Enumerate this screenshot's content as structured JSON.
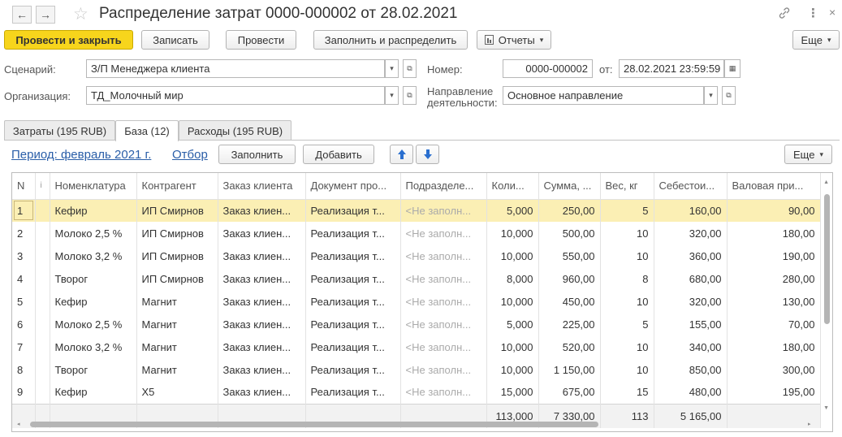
{
  "window": {
    "title": "Распределение затрат 0000-000002 от 28.02.2021",
    "back_icon": "←",
    "forward_icon": "→",
    "star_icon": "☆",
    "link_icon": "🔗",
    "more_icon": "⋮",
    "close_icon": "×"
  },
  "toolbar": {
    "post_close": "Провести и закрыть",
    "save": "Записать",
    "post": "Провести",
    "fill_distribute": "Заполнить и распределить",
    "reports": "Отчеты",
    "more": "Еще"
  },
  "form": {
    "scenario_label": "Сценарий:",
    "scenario_value": "З/П Менеджера клиента",
    "org_label": "Организация:",
    "org_value": "ТД_Молочный мир",
    "number_label": "Номер:",
    "number_value": "0000-000002",
    "date_label": "от:",
    "date_value": "28.02.2021 23:59:59",
    "direction_label_1": "Направление",
    "direction_label_2": "деятельности:",
    "direction_value": "Основное направление"
  },
  "tabs": [
    {
      "label": "Затраты (195 RUB)"
    },
    {
      "label": "База (12)"
    },
    {
      "label": "Расходы (195 RUB)"
    }
  ],
  "subbar": {
    "period": "Период: февраль 2021 г.",
    "filter": "Отбор",
    "fill": "Заполнить",
    "add": "Добавить",
    "up_icon": "🡅",
    "down_icon": "🡇",
    "more": "Еще"
  },
  "table": {
    "headers": [
      "N",
      "і",
      "Номенклатура",
      "Контрагент",
      "Заказ клиента",
      "Документ про...",
      "Подразделе...",
      "Коли...",
      "Сумма, ...",
      "Вес, кг",
      "Себестои...",
      "Валовая при..."
    ],
    "rows": [
      [
        "1",
        "Кефир",
        "ИП Смирнов",
        "Заказ клиен...",
        "Реализация т...",
        "<Не заполн...",
        "5,000",
        "250,00",
        "5",
        "160,00",
        "90,00"
      ],
      [
        "2",
        "Молоко 2,5 %",
        "ИП Смирнов",
        "Заказ клиен...",
        "Реализация т...",
        "<Не заполн...",
        "10,000",
        "500,00",
        "10",
        "320,00",
        "180,00"
      ],
      [
        "3",
        "Молоко 3,2 %",
        "ИП Смирнов",
        "Заказ клиен...",
        "Реализация т...",
        "<Не заполн...",
        "10,000",
        "550,00",
        "10",
        "360,00",
        "190,00"
      ],
      [
        "4",
        "Творог",
        "ИП Смирнов",
        "Заказ клиен...",
        "Реализация т...",
        "<Не заполн...",
        "8,000",
        "960,00",
        "8",
        "680,00",
        "280,00"
      ],
      [
        "5",
        "Кефир",
        "Магнит",
        "Заказ клиен...",
        "Реализация т...",
        "<Не заполн...",
        "10,000",
        "450,00",
        "10",
        "320,00",
        "130,00"
      ],
      [
        "6",
        "Молоко 2,5 %",
        "Магнит",
        "Заказ клиен...",
        "Реализация т...",
        "<Не заполн...",
        "5,000",
        "225,00",
        "5",
        "155,00",
        "70,00"
      ],
      [
        "7",
        "Молоко 3,2 %",
        "Магнит",
        "Заказ клиен...",
        "Реализация т...",
        "<Не заполн...",
        "10,000",
        "520,00",
        "10",
        "340,00",
        "180,00"
      ],
      [
        "8",
        "Творог",
        "Магнит",
        "Заказ клиен...",
        "Реализация т...",
        "<Не заполн...",
        "10,000",
        "1 150,00",
        "10",
        "850,00",
        "300,00"
      ],
      [
        "9",
        "Кефир",
        "X5",
        "Заказ клиен...",
        "Реализация т...",
        "<Не заполн...",
        "15,000",
        "675,00",
        "15",
        "480,00",
        "195,00"
      ]
    ],
    "totals": {
      "qty": "113,000",
      "sum": "7 330,00",
      "weight": "113",
      "cost": "5 165,00"
    }
  }
}
